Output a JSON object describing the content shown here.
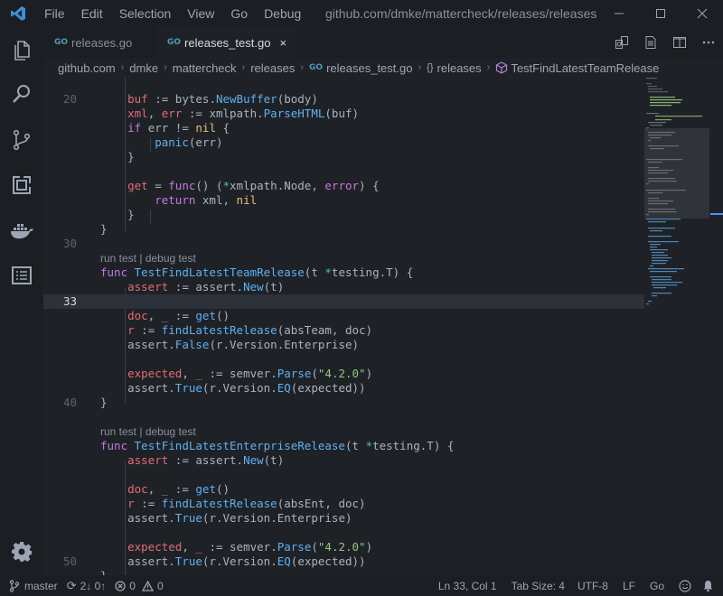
{
  "menu": [
    "File",
    "Edit",
    "Selection",
    "View",
    "Go",
    "Debug"
  ],
  "window_title": "github.com/dmke/mattercheck/releases/releases_...",
  "tabs": [
    {
      "badge": "GO",
      "label": "releases.go",
      "active": false
    },
    {
      "badge": "GO",
      "label": "releases_test.go",
      "active": true
    }
  ],
  "tab_close_glyph": "×",
  "breadcrumb": {
    "segments": [
      "github.com",
      "dmke",
      "mattercheck",
      "releases"
    ],
    "file_badge": "GO",
    "file": "releases_test.go",
    "symbol_glyph": "{}",
    "symbol": "releases",
    "function": "TestFindLatestTeamRelease"
  },
  "codelens": {
    "run": "run test",
    "sep": " | ",
    "debug": "debug test"
  },
  "code": {
    "l19_indent": "    ",
    "l20": [
      "buf",
      " := ",
      "bytes",
      ".",
      "NewBuffer",
      "(",
      "body",
      ")"
    ],
    "l21": [
      "xml",
      ", ",
      "err",
      " := ",
      "xmlpath",
      ".",
      "ParseHTML",
      "(",
      "buf",
      ")"
    ],
    "l22": [
      "if",
      " ",
      "err",
      " != ",
      "nil",
      " {"
    ],
    "l23": [
      "panic",
      "(",
      "err",
      ")"
    ],
    "l24": "}",
    "l26": [
      "get",
      " = ",
      "func",
      "() (",
      "*",
      "xmlpath",
      ".",
      "Node",
      ", ",
      "error",
      ") {"
    ],
    "l27": [
      "return",
      " ",
      "xml",
      ", ",
      "nil"
    ],
    "l28": "}",
    "l29": "}",
    "l31": [
      "func",
      " ",
      "TestFindLatestTeamRelease",
      "(",
      "t",
      " ",
      "*",
      "testing",
      ".",
      "T",
      ") {"
    ],
    "l32": [
      "assert",
      " := ",
      "assert",
      ".",
      "New",
      "(",
      "t",
      ")"
    ],
    "l34": [
      "doc",
      ", ",
      "_",
      " := ",
      "get",
      "()"
    ],
    "l35": [
      "r",
      " := ",
      "findLatestRelease",
      "(",
      "absTeam",
      ", ",
      "doc",
      ")"
    ],
    "l36": [
      "assert",
      ".",
      "False",
      "(",
      "r",
      ".",
      "Version",
      ".",
      "Enterprise",
      ")"
    ],
    "l38": [
      "expected",
      ", ",
      "_",
      " := ",
      "semver",
      ".",
      "Parse",
      "(",
      "\"4.2.0\"",
      ")"
    ],
    "l39": [
      "assert",
      ".",
      "True",
      "(",
      "r",
      ".",
      "Version",
      ".",
      "EQ",
      "(",
      "expected",
      "))"
    ],
    "l40": "}",
    "l42": [
      "func",
      " ",
      "TestFindLatestEnterpriseRelease",
      "(",
      "t",
      " ",
      "*",
      "testing",
      ".",
      "T",
      ") {"
    ],
    "l43": [
      "assert",
      " := ",
      "assert",
      ".",
      "New",
      "(",
      "t",
      ")"
    ],
    "l45": [
      "doc",
      ", ",
      "_",
      " := ",
      "get",
      "()"
    ],
    "l46": [
      "r",
      " := ",
      "findLatestRelease",
      "(",
      "absEnt",
      ", ",
      "doc",
      ")"
    ],
    "l47": [
      "assert",
      ".",
      "True",
      "(",
      "r",
      ".",
      "Version",
      ".",
      "Enterprise",
      ")"
    ],
    "l49": [
      "expected",
      ", ",
      "_",
      " := ",
      "semver",
      ".",
      "Parse",
      "(",
      "\"4.2.0\"",
      ")"
    ],
    "l50": [
      "assert",
      ".",
      "True",
      "(",
      "r",
      ".",
      "Version",
      ".",
      "EQ",
      "(",
      "expected",
      "))"
    ],
    "l51": "}"
  },
  "line_numbers": {
    "n20": "20",
    "n30": "30",
    "n33": "33",
    "n40": "40",
    "n50": "50"
  },
  "status": {
    "branch": "master",
    "sync": "2↓ 0↑",
    "errors": "0",
    "warnings": "0",
    "position": "Ln 33, Col 1",
    "tab_size": "Tab Size: 4",
    "encoding": "UTF-8",
    "eol": "LF",
    "language": "Go"
  },
  "colors": {
    "accent": "#528bff",
    "background": "#1e2227",
    "chrome": "#1b1e22",
    "keyword": "#c678dd",
    "function": "#61afef",
    "variable": "#e06c75",
    "string": "#98c379",
    "type": "#e5c07b"
  }
}
